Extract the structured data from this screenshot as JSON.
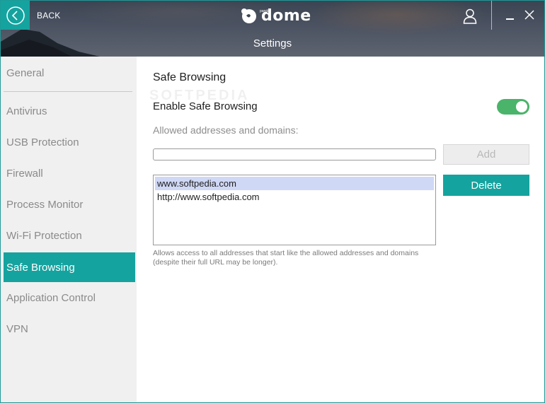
{
  "header": {
    "back_label": "BACK",
    "brand": "dome",
    "brand_sub": "panda",
    "icons": [
      "back-arrow-icon",
      "panda-logo-icon",
      "user-icon",
      "minimize-icon",
      "close-icon"
    ]
  },
  "page": {
    "title": "Settings"
  },
  "sidebar": {
    "items": [
      {
        "label": "General"
      },
      {
        "label": "Antivirus"
      },
      {
        "label": "USB Protection"
      },
      {
        "label": "Firewall"
      },
      {
        "label": "Process Monitor"
      },
      {
        "label": "Wi-Fi Protection"
      },
      {
        "label": "Safe Browsing"
      },
      {
        "label": "Application Control"
      },
      {
        "label": "VPN"
      }
    ],
    "active": "Safe Browsing"
  },
  "main": {
    "section_title": "Safe Browsing",
    "watermark": "SOFTPEDIA",
    "enable_label": "Enable Safe Browsing",
    "enable_on": true,
    "allowed_label": "Allowed addresses and domains:",
    "input_value": "",
    "add_label": "Add",
    "delete_label": "Delete",
    "list": [
      {
        "value": "www.softpedia.com",
        "selected": true
      },
      {
        "value": "http://www.softpedia.com",
        "selected": false
      }
    ],
    "help_text": "Allows access to all addresses that start like the allowed addresses and domains (despite their full URL may be longer)."
  },
  "colors": {
    "accent": "#15a39f",
    "toggle_on": "#4ab46a",
    "selection": "#cfd8f5"
  }
}
